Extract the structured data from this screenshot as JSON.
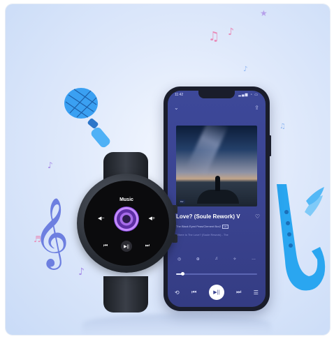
{
  "phone": {
    "status_time": "11:42",
    "status_icons": "▂▄▆ ◔ ▭",
    "back_icon": "chevron-down-icon",
    "share_icon": "share-icon",
    "art_tag": "MV",
    "song_title": "Love? (Soule Rework) V",
    "artist": "The Black Eyed Peas/Clement Bcx2",
    "artist_badge": "HD",
    "lyric": "Where is The Love? (Soule Rework) - The",
    "tools": [
      "◎",
      "⊕",
      "♫",
      "✧",
      "…"
    ],
    "progress": 0.08,
    "controls": [
      "⟲",
      "⏮",
      "▶||",
      "⏭",
      "☰"
    ],
    "colors": {
      "screen_top": "#3d4899",
      "screen_bottom": "#343c83",
      "accent": "#ffffff"
    }
  },
  "watch": {
    "title": "Music",
    "vol_down": "◀−",
    "vol_up": "◀+",
    "controls": [
      "⏮",
      "▶||",
      "⏭"
    ],
    "colors": {
      "disc": "#a66be8",
      "face": "#0b0b0d"
    }
  },
  "decor": {
    "notes": [
      "♫",
      "♪",
      "♪",
      "♫",
      "♪",
      "♬",
      "♪",
      "★"
    ],
    "clef": "𝄞",
    "colors": {
      "mic": "#3aa0f2",
      "sax": "#2aa6f0",
      "clef": "#6d7fe0",
      "note_pink": "#e98ab8",
      "note_purple": "#a78ce8"
    }
  }
}
